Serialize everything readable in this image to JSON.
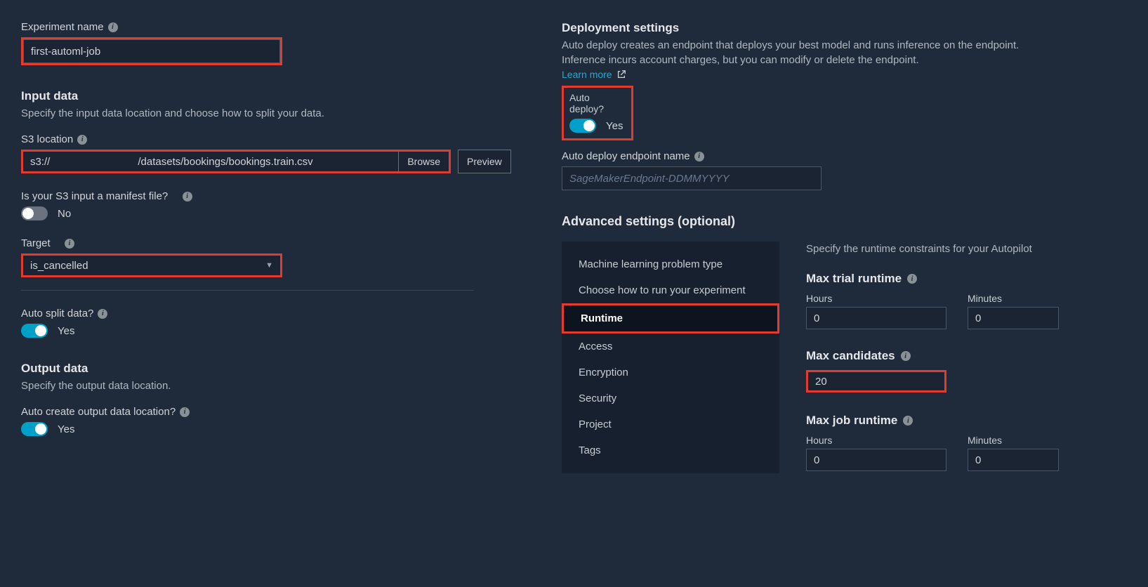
{
  "left": {
    "experiment_name_label": "Experiment name",
    "experiment_name_value": "first-automl-job",
    "input_data": {
      "title": "Input data",
      "desc": "Specify the input data location and choose how to split your data."
    },
    "s3_location_label": "S3 location",
    "s3_location_value": "s3://                              /datasets/bookings/bookings.train.csv",
    "browse_label": "Browse",
    "preview_label": "Preview",
    "manifest_label": "Is your S3 input a manifest file?",
    "manifest_value": "No",
    "target_label": "Target",
    "target_value": "is_cancelled",
    "auto_split_label": "Auto split data?",
    "auto_split_value": "Yes",
    "output_data": {
      "title": "Output data",
      "desc": "Specify the output data location."
    },
    "auto_create_output_label": "Auto create output data location?",
    "auto_create_output_value": "Yes"
  },
  "right": {
    "deployment": {
      "title": "Deployment settings",
      "desc": "Auto deploy creates an endpoint that deploys your best model and runs inference on the endpoint. Inference incurs account charges, but you can modify or delete the endpoint.",
      "learn_more": "Learn more",
      "auto_deploy_label": "Auto deploy?",
      "auto_deploy_value": "Yes",
      "endpoint_name_label": "Auto deploy endpoint name",
      "endpoint_name_placeholder": "SageMakerEndpoint-DDMMYYYY"
    },
    "advanced": {
      "title": "Advanced settings (optional)",
      "nav": [
        "Machine learning problem type",
        "Choose how to run your experiment",
        "Runtime",
        "Access",
        "Encryption",
        "Security",
        "Project",
        "Tags"
      ],
      "runtime_desc": "Specify the runtime constraints for your Autopilot",
      "max_trial_label": "Max trial runtime",
      "hours_label": "Hours",
      "minutes_label": "Minutes",
      "trial_hours": "0",
      "trial_minutes": "0",
      "max_candidates_label": "Max candidates",
      "max_candidates_value": "20",
      "max_job_label": "Max job runtime",
      "job_hours": "0",
      "job_minutes": "0"
    }
  }
}
